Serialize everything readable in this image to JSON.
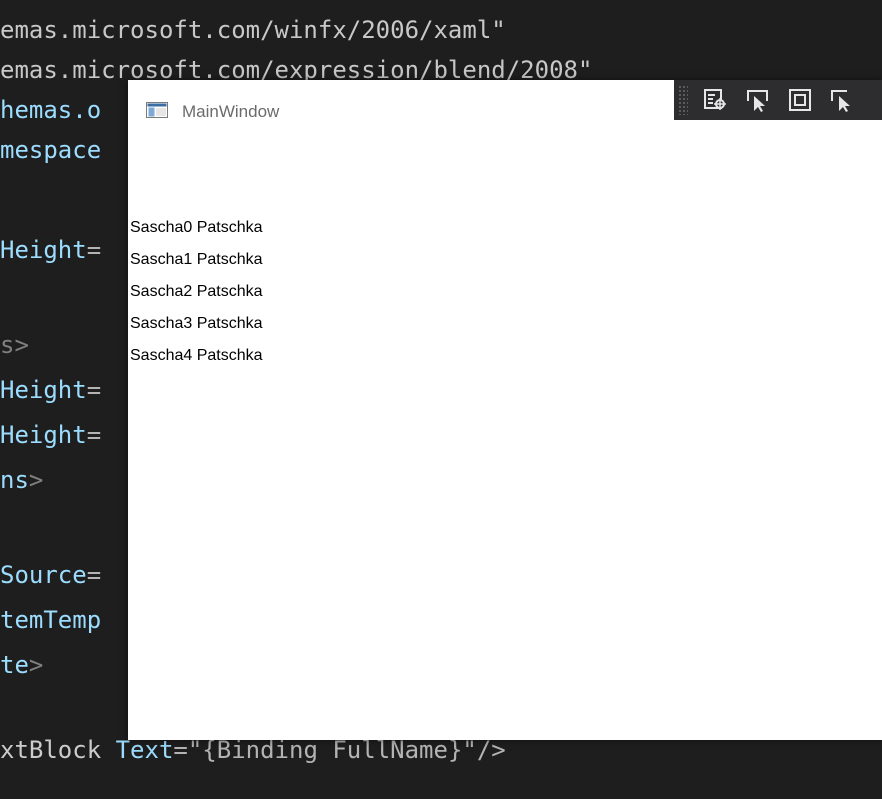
{
  "editor": {
    "lines": [
      {
        "parts": [
          {
            "t": "emas.microsoft.com/winfx/2006/xaml\"",
            "c": "c-str"
          }
        ]
      },
      {
        "parts": [
          {
            "t": "emas.microsoft.com/expression/blend/2008\"",
            "c": "c-str"
          }
        ]
      },
      {
        "parts": [
          {
            "t": "hemas.o",
            "c": "c-attr"
          }
        ]
      },
      {
        "parts": [
          {
            "t": "mespace",
            "c": "c-attr"
          }
        ]
      },
      {
        "parts": []
      },
      {
        "parts": [
          {
            "t": "Height",
            "c": "c-attr"
          },
          {
            "t": "=",
            "c": "c-op"
          }
        ]
      },
      {
        "parts": []
      },
      {
        "parts": [
          {
            "t": "s>",
            "c": "c-tag"
          }
        ]
      },
      {
        "parts": [
          {
            "t": "Height",
            "c": "c-attr"
          },
          {
            "t": "=",
            "c": "c-op"
          }
        ]
      },
      {
        "parts": [
          {
            "t": "Height",
            "c": "c-attr"
          },
          {
            "t": "=",
            "c": "c-op"
          }
        ]
      },
      {
        "parts": [
          {
            "t": "ns",
            "c": "c-attr"
          },
          {
            "t": ">",
            "c": "c-tag"
          }
        ]
      },
      {
        "parts": []
      },
      {
        "parts": [
          {
            "t": "Source",
            "c": "c-attr"
          },
          {
            "t": "=",
            "c": "c-op"
          }
        ]
      },
      {
        "parts": [
          {
            "t": "temTemp",
            "c": "c-attr"
          }
        ]
      },
      {
        "parts": [
          {
            "t": "te",
            "c": "c-attr"
          },
          {
            "t": ">",
            "c": "c-tag"
          }
        ]
      },
      {
        "parts": []
      },
      {
        "parts": [
          {
            "t": "xtBlock",
            "c": "c-bind"
          },
          {
            "t": " Text",
            "c": "c-attr"
          },
          {
            "t": "=\"{Binding FullName}\"/>",
            "c": "c-op"
          }
        ]
      }
    ]
  },
  "toolbar": {
    "buttons": [
      {
        "icon": "live-visual-tree-icon"
      },
      {
        "icon": "select-element-icon"
      },
      {
        "icon": "display-layout-adorners-icon"
      },
      {
        "icon": "track-focused-element-icon"
      }
    ]
  },
  "window": {
    "title": "MainWindow",
    "icon": "wpf-window-icon"
  },
  "list": {
    "items": [
      "Sascha0 Patschka",
      "Sascha1 Patschka",
      "Sascha2 Patschka",
      "Sascha3 Patschka",
      "Sascha4 Patschka"
    ]
  }
}
